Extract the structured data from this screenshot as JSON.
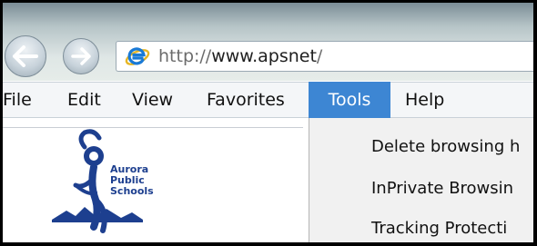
{
  "address": {
    "url_prefix": "http://",
    "url_host": "www.apsnet",
    "url_suffix": "/"
  },
  "menu": [
    {
      "label": "File"
    },
    {
      "label": "Edit"
    },
    {
      "label": "View"
    },
    {
      "label": "Favorites"
    },
    {
      "label": "Tools",
      "active": true
    },
    {
      "label": "Help"
    }
  ],
  "tools_menu": {
    "items": [
      {
        "label": "Delete browsing h"
      },
      {
        "label": "InPrivate Browsin"
      },
      {
        "label": "Tracking Protecti"
      }
    ]
  },
  "logo": {
    "line1": "Aurora",
    "line2": "Public",
    "line3": "Schools"
  },
  "colors": {
    "menu_highlight": "#3d86d3",
    "logo_blue": "#1d3f8f",
    "ie_blue": "#1a7ad6",
    "ie_gold": "#e7b625"
  },
  "icons": {
    "back": "arrow-left-icon",
    "forward": "arrow-right-icon",
    "browser": "internet-explorer-icon"
  }
}
